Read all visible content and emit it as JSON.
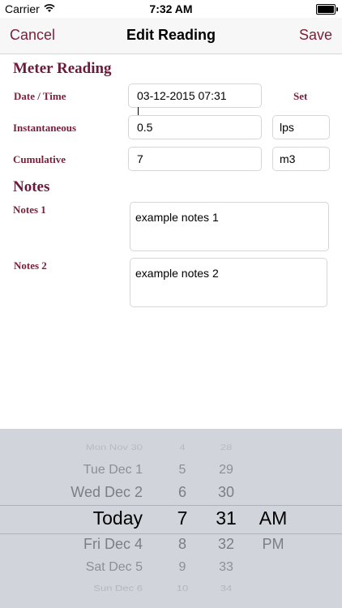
{
  "status": {
    "carrier": "Carrier",
    "time": "7:32 AM"
  },
  "nav": {
    "cancel": "Cancel",
    "title": "Edit Reading",
    "save": "Save"
  },
  "meter": {
    "heading": "Meter Reading",
    "date_label": "Date / Time",
    "date_value": "03-12-2015 07:31",
    "set_label": "Set",
    "inst_label": "Instantaneous",
    "inst_value": "0.5",
    "inst_unit": "lps",
    "cum_label": "Cumulative",
    "cum_value": "7",
    "cum_unit": "m3"
  },
  "notes": {
    "heading": "Notes",
    "notes1_label": "Notes 1",
    "notes1_value": "example notes 1",
    "notes2_label": "Notes 2",
    "notes2_value": "example notes 2"
  },
  "picker": {
    "rows": [
      {
        "day": "Mon Nov 30",
        "hour": "4",
        "minute": "28",
        "ampm": ""
      },
      {
        "day": "Tue Dec 1",
        "hour": "5",
        "minute": "29",
        "ampm": ""
      },
      {
        "day": "Wed Dec 2",
        "hour": "6",
        "minute": "30",
        "ampm": ""
      },
      {
        "day": "Today",
        "hour": "7",
        "minute": "31",
        "ampm": "AM"
      },
      {
        "day": "Fri Dec 4",
        "hour": "8",
        "minute": "32",
        "ampm": "PM"
      },
      {
        "day": "Sat Dec 5",
        "hour": "9",
        "minute": "33",
        "ampm": ""
      },
      {
        "day": "Sun Dec 6",
        "hour": "10",
        "minute": "34",
        "ampm": ""
      }
    ],
    "selected_index": 3
  },
  "colors": {
    "accent": "#7a1f3a",
    "heading": "#6b1a3a",
    "picker_bg": "#d1d5db"
  }
}
